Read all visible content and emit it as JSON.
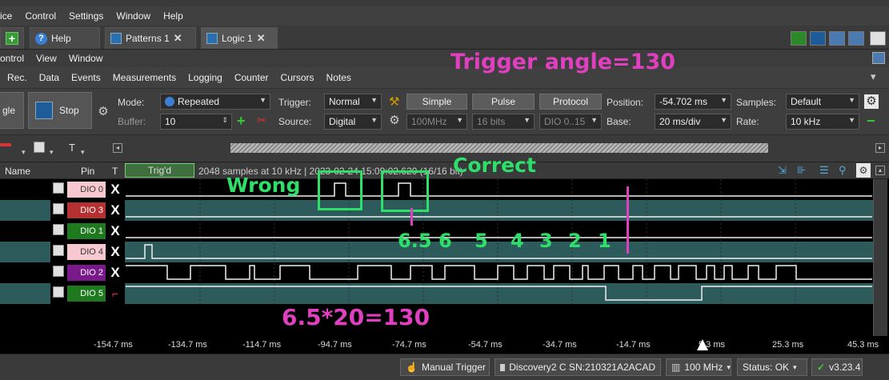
{
  "menubar": [
    "ice",
    "Control",
    "Settings",
    "Window",
    "Help"
  ],
  "tabs": [
    {
      "label": "Help",
      "icon": "help-icon"
    },
    {
      "label": "Patterns 1",
      "icon": "patterns-icon"
    },
    {
      "label": "Logic 1",
      "icon": "logic-icon"
    }
  ],
  "submenu": [
    "ontrol",
    "View",
    "Window"
  ],
  "toolbar1": [
    "Rec.",
    "Data",
    "Events",
    "Measurements",
    "Logging",
    "Counter",
    "Cursors",
    "Notes"
  ],
  "controls": {
    "single_label": "gle",
    "stop_label": "Stop",
    "mode_label": "Mode:",
    "mode_value": "Repeated",
    "buffer_label": "Buffer:",
    "buffer_value": "10",
    "trigger_label": "Trigger:",
    "trigger_value": "Normal",
    "source_label": "Source:",
    "source_value": "Digital",
    "simple": "Simple",
    "pulse": "Pulse",
    "protocol": "Protocol",
    "rate_combo": "100MHz",
    "bits_combo": "16 bits",
    "dio_combo": "DIO 0..15",
    "position_label": "Position:",
    "position_value": "-54.702 ms",
    "base_label": "Base:",
    "base_value": "20 ms/div",
    "samples_label": "Samples:",
    "samples_value": "Default",
    "rate_label": "Rate:",
    "rate_value": "10 kHz"
  },
  "table_header": {
    "name": "Name",
    "pin": "Pin",
    "t": "T",
    "trig": "Trig'd",
    "info": "2048 samples at 10 kHz | 2023-02-24 15:09:02.620 (16/16 bit)"
  },
  "channels": [
    {
      "pin": "DIO 0",
      "color": "#f7c8d0",
      "text_color": "#333",
      "trigger": "X"
    },
    {
      "pin": "DIO 3",
      "color": "#b53030",
      "text_color": "#fff",
      "trigger": "X"
    },
    {
      "pin": "DIO 1",
      "color": "#1f7a1f",
      "text_color": "#fff",
      "trigger": "X"
    },
    {
      "pin": "DIO 4",
      "color": "#f7c8d0",
      "text_color": "#333",
      "trigger": "X"
    },
    {
      "pin": "DIO 2",
      "color": "#7a1a8a",
      "text_color": "#fff",
      "trigger": "X"
    },
    {
      "pin": "DIO 5",
      "color": "#1f7a1f",
      "text_color": "#fff",
      "trigger": "rising-edge"
    }
  ],
  "time_axis": [
    "-154.7 ms",
    "-134.7 ms",
    "-114.7 ms",
    "-94.7 ms",
    "-74.7 ms",
    "-54.7 ms",
    "-34.7 ms",
    "-14.7 ms",
    "5.3 ms",
    "25.3 ms",
    "45.3 ms"
  ],
  "annotations": {
    "trigger_angle": "Trigger angle=130",
    "wrong": "Wrong",
    "correct": "Correct",
    "countdown": [
      "6.5",
      "6",
      "5",
      "4",
      "3",
      "2",
      "1"
    ],
    "formula": "6.5*20=130"
  },
  "statusbar": {
    "manual_trigger": "Manual Trigger",
    "device": "Discovery2 C SN:210321A2ACAD",
    "clock": "100 MHz",
    "status": "Status: OK",
    "version": "v3.23.4"
  },
  "colors": {
    "annotation_pink": "#e040c0",
    "annotation_green": "#2ee06a",
    "wave_line": "#f0f0f0",
    "teal_row": "#2d5a5a"
  }
}
